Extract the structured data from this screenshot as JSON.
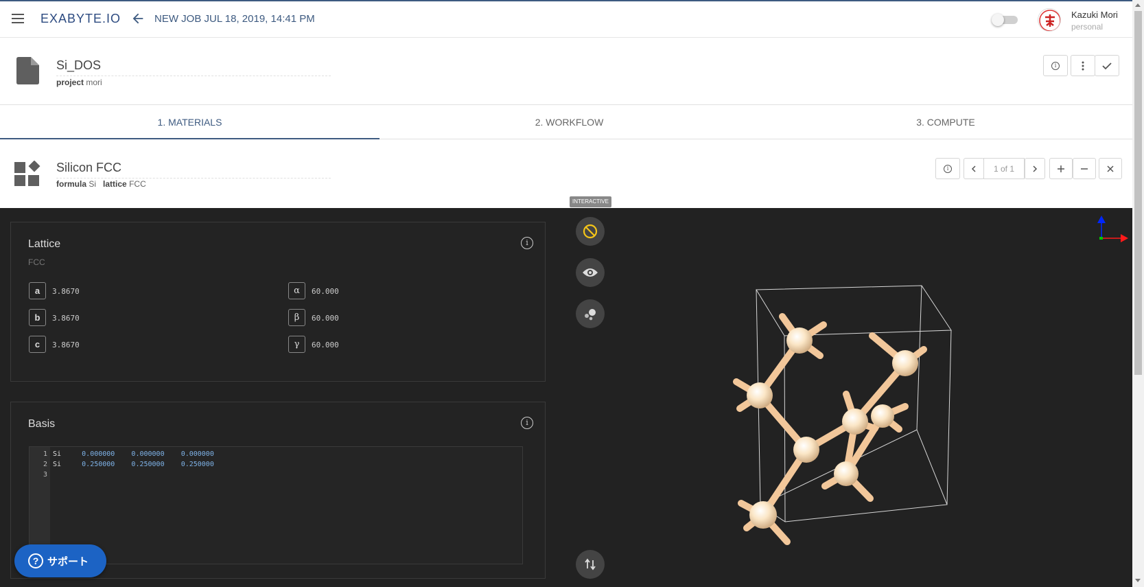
{
  "header": {
    "logo": "EXABYTE.IO",
    "job_title": "NEW JOB JUL 18, 2019, 14:41 PM",
    "user_name": "Kazuki Mori",
    "account_type": "personal"
  },
  "job": {
    "name": "Si_DOS",
    "project_label": "project",
    "project_value": "mori"
  },
  "tabs": [
    {
      "label": "1. MATERIALS",
      "active": true
    },
    {
      "label": "2. WORKFLOW",
      "active": false
    },
    {
      "label": "3. COMPUTE",
      "active": false
    }
  ],
  "material": {
    "name": "Silicon FCC",
    "formula_label": "formula",
    "formula_value": "Si",
    "lattice_label": "lattice",
    "lattice_value": "FCC",
    "pager": "1 of 1"
  },
  "viewer": {
    "mode_tag": "INTERACTIVE"
  },
  "lattice": {
    "title": "Lattice",
    "type": "FCC",
    "params": [
      {
        "key": "a",
        "value": "3.8670"
      },
      {
        "key": "b",
        "value": "3.8670"
      },
      {
        "key": "c",
        "value": "3.8670"
      },
      {
        "key": "α",
        "value": "60.000"
      },
      {
        "key": "β",
        "value": "60.000"
      },
      {
        "key": "γ",
        "value": "60.000"
      }
    ]
  },
  "basis": {
    "title": "Basis",
    "lines": [
      {
        "n": "1",
        "element": "Si",
        "x": "0.000000",
        "y": "0.000000",
        "z": "0.000000"
      },
      {
        "n": "2",
        "element": "Si",
        "x": "0.250000",
        "y": "0.250000",
        "z": "0.250000"
      },
      {
        "n": "3",
        "element": "",
        "x": "",
        "y": "",
        "z": ""
      }
    ]
  },
  "support": {
    "label": "サポート",
    "q": "?"
  },
  "colors": {
    "brand": "#3d5a80",
    "dark_bg": "#222222",
    "atom": "#f5dcb4",
    "bond": "#f2c79a",
    "support_bg": "#1c63c4"
  }
}
